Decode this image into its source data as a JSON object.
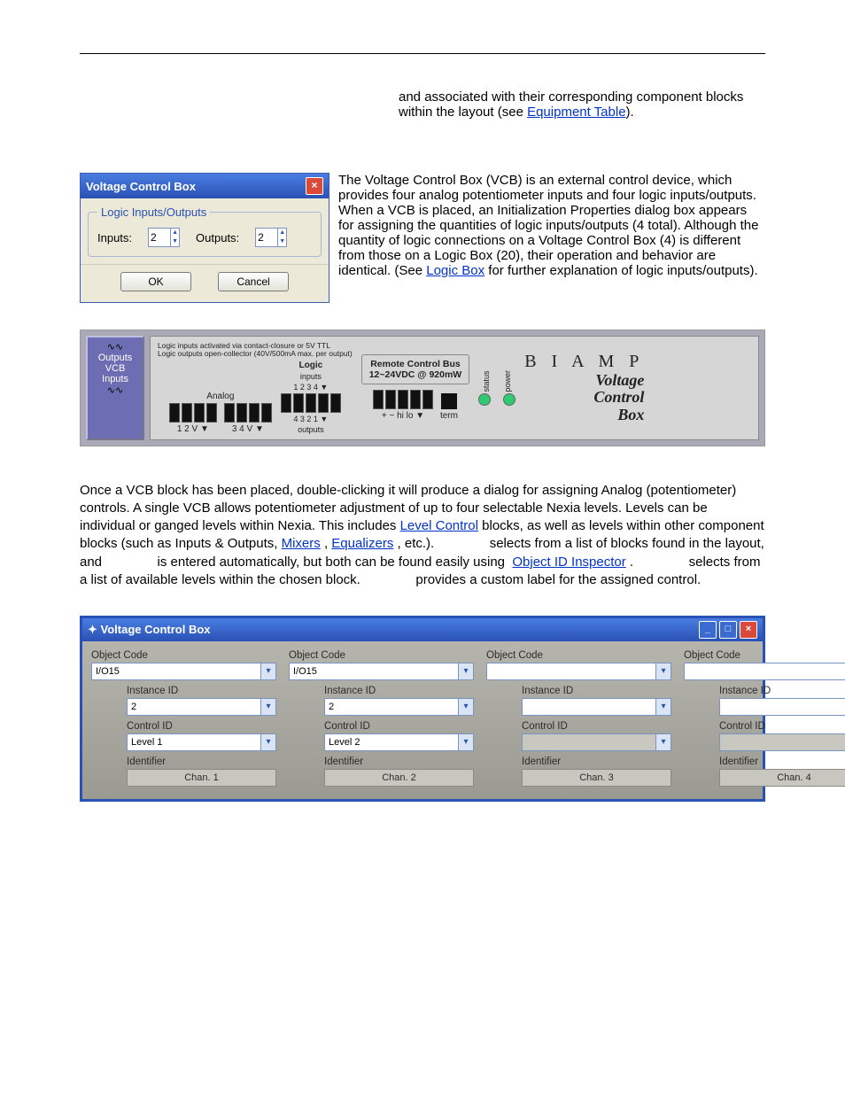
{
  "top": {
    "line1": "and associated with their corresponding component blocks within the layout (see ",
    "link": "Equipment Table",
    "close": ")."
  },
  "dialog": {
    "title": "Voltage Control Box",
    "legend": "Logic Inputs/Outputs",
    "inputs_label": "Inputs:",
    "inputs_value": "2",
    "outputs_label": "Outputs:",
    "outputs_value": "2",
    "ok": "OK",
    "cancel": "Cancel"
  },
  "para1": {
    "pre": "The Voltage Control Box (VCB) is an external control device, which provides four analog potentiometer inputs and four logic inputs/outputs. When a VCB is placed, an Initialization Properties dialog box appears for assigning the quantities of logic inputs/outputs (4 total). Although the quantity of logic connections on a Voltage Control Box (4) is different from those on a Logic Box (20), their operation and behavior are identical. (See ",
    "link": "Logic Box",
    "post": " for further explanation of logic inputs/outputs)."
  },
  "hw": {
    "block_outputs": "Outputs",
    "block_vcb": "VCB",
    "block_inputs": "Inputs",
    "fineprint1": "Logic inputs activated via contact-closure or 5V TTL",
    "fineprint2": "Logic outputs open-collector (40V/500mA max. per output)",
    "analog_label": "Analog",
    "logic_label": "Logic",
    "inputs_label": "inputs",
    "outputs_label": "outputs",
    "nums_a": "1  2  V  ▼",
    "nums_b": "3  4  V  ▼",
    "logic_in_nums": "1  2  3  4  ▼",
    "logic_out_nums": "4  3  2  1  ▼",
    "remote_line1": "Remote Control Bus",
    "remote_line2": "12~24VDC @ 920mW",
    "hi_lo": "+  −   hi  lo  ▼",
    "term": "term",
    "status": "status",
    "power": "power",
    "brand": "B I A M P",
    "brand_sub1": "Voltage",
    "brand_sub2": "Control",
    "brand_sub3": "Box"
  },
  "body2": {
    "t1": "Once a VCB block has been placed, double-clicking it will produce a dialog for assigning Analog (potentiometer) controls. A single VCB allows potentiometer adjustment of up to four selectable Nexia levels. Levels can be individual or ganged levels within Nexia. This includes ",
    "link_level": "Level Control",
    "t2": " blocks, as well as levels within other component blocks (such as Inputs & Outputs, ",
    "link_mixers": "Mixers",
    "t3": ", ",
    "link_eq": "Equalizers",
    "t4": ", etc.).               selects from a list of blocks found in the layout, and               is entered automatically, but both can be found easily using ",
    "link_obj": "Object ID Inspector",
    "t5": ".               selects from a list of available levels within the chosen block.               provides a custom label for the assigned control."
  },
  "vcb": {
    "title": "Voltage Control Box",
    "labels": {
      "object_code": "Object Code",
      "instance_id": "Instance ID",
      "control_id": "Control ID",
      "identifier": "Identifier"
    },
    "cols": [
      {
        "object_code": "I/O15",
        "instance_id": "2",
        "control_id": "Level 1",
        "identifier": "Chan. 1",
        "filled": true
      },
      {
        "object_code": "I/O15",
        "instance_id": "2",
        "control_id": "Level 2",
        "identifier": "Chan. 2",
        "filled": true
      },
      {
        "object_code": "",
        "instance_id": "",
        "control_id": "",
        "identifier": "Chan. 3",
        "filled": false
      },
      {
        "object_code": "",
        "instance_id": "",
        "control_id": "",
        "identifier": "Chan. 4",
        "filled": false
      }
    ]
  }
}
